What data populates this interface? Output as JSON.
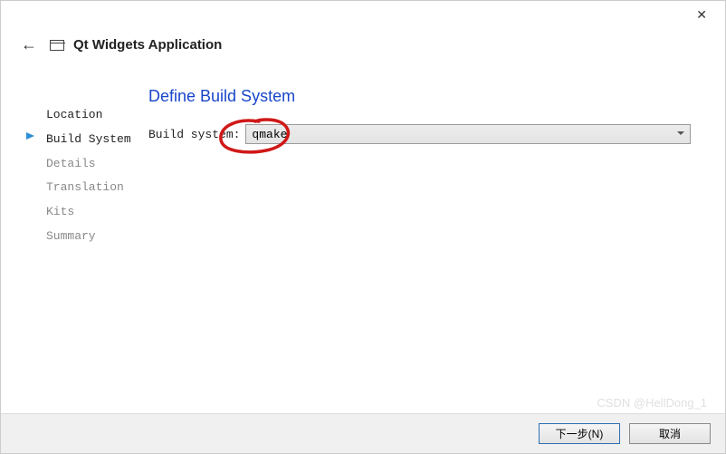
{
  "window": {
    "close_icon": "✕"
  },
  "header": {
    "back_arrow": "←",
    "title": "Qt Widgets Application"
  },
  "sidebar": {
    "items": [
      {
        "label": "Location",
        "state": "done"
      },
      {
        "label": "Build System",
        "state": "active"
      },
      {
        "label": "Details",
        "state": "pending"
      },
      {
        "label": "Translation",
        "state": "pending"
      },
      {
        "label": "Kits",
        "state": "pending"
      },
      {
        "label": "Summary",
        "state": "pending"
      }
    ]
  },
  "main": {
    "title": "Define Build System",
    "form": {
      "build_system_label": "Build system:",
      "build_system_value": "qmake"
    }
  },
  "footer": {
    "next_label": "下一步(N)",
    "cancel_label": "取消"
  },
  "watermark": "CSDN @HellDong_1"
}
